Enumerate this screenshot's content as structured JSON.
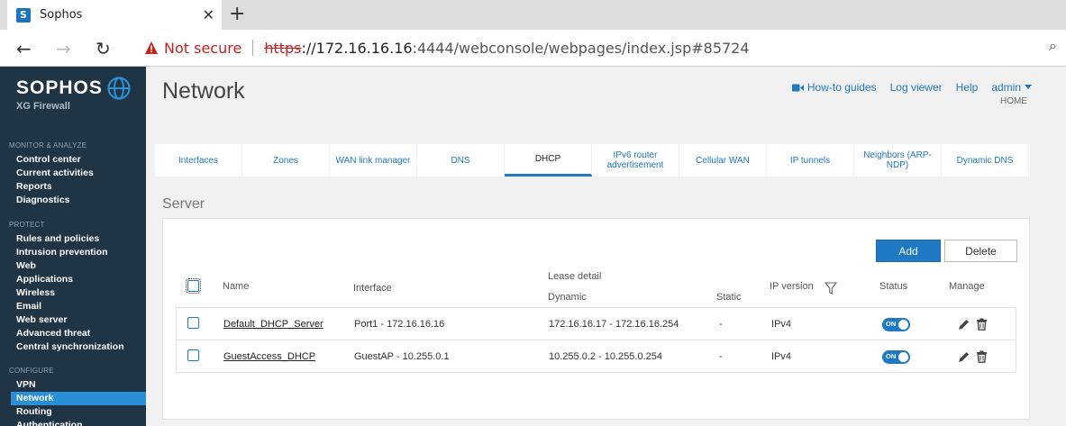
{
  "browser": {
    "tab_title": "Sophos",
    "favicon_letter": "S",
    "close_glyph": "✕",
    "newtab_glyph": "+",
    "not_secure": "Not secure",
    "url_proto": "https",
    "url_host": "://172.16.16.16",
    "url_rest": ":4444/webconsole/webpages/index.jsp#85724"
  },
  "brand": {
    "name": "SOPHOS",
    "subtitle": "XG Firewall"
  },
  "sidebar": {
    "sections": [
      {
        "title": "MONITOR & ANALYZE",
        "items": [
          "Control center",
          "Current activities",
          "Reports",
          "Diagnostics"
        ]
      },
      {
        "title": "PROTECT",
        "items": [
          "Rules and policies",
          "Intrusion prevention",
          "Web",
          "Applications",
          "Wireless",
          "Email",
          "Web server",
          "Advanced threat",
          "Central synchronization"
        ]
      },
      {
        "title": "CONFIGURE",
        "items": [
          "VPN",
          "Network",
          "Routing",
          "Authentication"
        ]
      }
    ],
    "active_item": "Network"
  },
  "header": {
    "title": "Network",
    "links": {
      "howto": "How-to guides",
      "log_viewer": "Log viewer",
      "help": "Help",
      "admin": "admin"
    },
    "home": "HOME"
  },
  "tabs": [
    {
      "label": "Interfaces",
      "active": false
    },
    {
      "label": "Zones",
      "active": false
    },
    {
      "label": "WAN link manager",
      "active": false
    },
    {
      "label": "DNS",
      "active": false
    },
    {
      "label": "DHCP",
      "active": true
    },
    {
      "label": "IPv6 router advertisement",
      "active": false
    },
    {
      "label": "Cellular WAN",
      "active": false
    },
    {
      "label": "IP tunnels",
      "active": false
    },
    {
      "label": "Neighbors (ARP-NDP)",
      "active": false
    },
    {
      "label": "Dynamic DNS",
      "active": false
    }
  ],
  "server": {
    "section_title": "Server",
    "add_label": "Add",
    "delete_label": "Delete",
    "columns": {
      "name": "Name",
      "interface": "Interface",
      "lease_detail": "Lease detail",
      "dynamic": "Dynamic",
      "static": "Static",
      "ip_version": "IP version",
      "status": "Status",
      "manage": "Manage"
    },
    "rows": [
      {
        "name": "Default_DHCP_Server",
        "interface": "Port1 - 172.16.16.16",
        "dynamic": "172.16.16.17 - 172.16.16.254",
        "static": "-",
        "ip_version": "IPv4",
        "status": "ON"
      },
      {
        "name": "GuestAccess_DHCP",
        "interface": "GuestAP - 10.255.0.1",
        "dynamic": "10.255.0.2 - 10.255.0.254",
        "static": "-",
        "ip_version": "IPv4",
        "status": "ON"
      }
    ]
  },
  "colors": {
    "sidebar_bg": "#1f3445",
    "accent": "#1e78c2",
    "active_nav": "#2b8fd6",
    "not_secure": "#c5221f"
  }
}
